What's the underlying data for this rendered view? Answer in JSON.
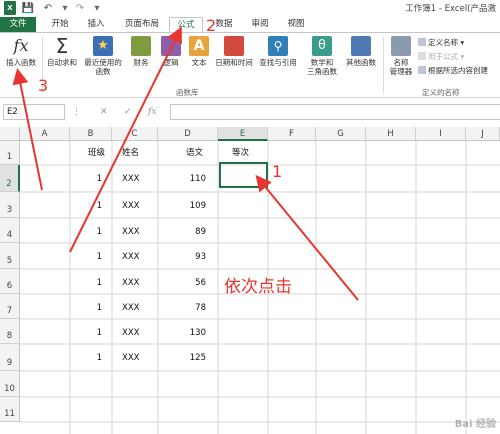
{
  "title_bar": {
    "window_title": "工作簿1 - Excel(产品激"
  },
  "tabs": [
    {
      "label": "文件",
      "active": false
    },
    {
      "label": "开始",
      "active": false
    },
    {
      "label": "插入",
      "active": false
    },
    {
      "label": "页面布局",
      "active": false
    },
    {
      "label": "公式",
      "active": true
    },
    {
      "label": "数据",
      "active": false
    },
    {
      "label": "审阅",
      "active": false
    },
    {
      "label": "视图",
      "active": false
    }
  ],
  "ribbon": {
    "buttons": [
      {
        "label": "插入函数",
        "icon": "fx-icon"
      },
      {
        "label": "自动求和",
        "icon": "sigma-icon"
      },
      {
        "label": "最近使用的\n函数",
        "icon": "star-icon"
      },
      {
        "label": "财务",
        "icon": "finance-icon"
      },
      {
        "label": "逻辑",
        "icon": "logic-icon"
      },
      {
        "label": "文本",
        "icon": "text-icon"
      },
      {
        "label": "日期和时间",
        "icon": "calendar-icon"
      },
      {
        "label": "查找与引用",
        "icon": "lookup-icon"
      },
      {
        "label": "数学和\n三角函数",
        "icon": "math-icon"
      },
      {
        "label": "其他函数",
        "icon": "more-functions-icon"
      },
      {
        "label": "名称\n管理器",
        "icon": "name-manager-icon"
      }
    ],
    "group_function_library": "函数库",
    "group_defined_names": "定义的名称",
    "define_name": "定义名称 ▾",
    "use_in_formula": "用于公式 ▾",
    "create_from_selection": "根据所选内容创建"
  },
  "formula_bar": {
    "name_box": "E2",
    "value": ""
  },
  "columns": [
    "A",
    "B",
    "C",
    "D",
    "E",
    "F",
    "G",
    "H",
    "I",
    "J"
  ],
  "selected_column": "E",
  "rows": [
    "1",
    "2",
    "3",
    "4",
    "5",
    "6",
    "7",
    "8",
    "9",
    "10",
    "11"
  ],
  "selected_row": "2",
  "table": {
    "headers": [
      "班级",
      "姓名",
      "语文",
      "等次"
    ],
    "data": [
      [
        "1",
        "XXX",
        "110"
      ],
      [
        "1",
        "XXX",
        "109"
      ],
      [
        "1",
        "XXX",
        "89"
      ],
      [
        "1",
        "XXX",
        "93"
      ],
      [
        "1",
        "XXX",
        "56"
      ],
      [
        "1",
        "XXX",
        "78"
      ],
      [
        "1",
        "XXX",
        "130"
      ],
      [
        "1",
        "XXX",
        "125"
      ]
    ]
  },
  "annotations": {
    "step1": "1",
    "step2": "2",
    "step3": "3",
    "instruction": "依次点击"
  },
  "watermark": "Bai 经验",
  "colors": {
    "excel_green": "#217346",
    "annotation_red": "#e8352f"
  }
}
